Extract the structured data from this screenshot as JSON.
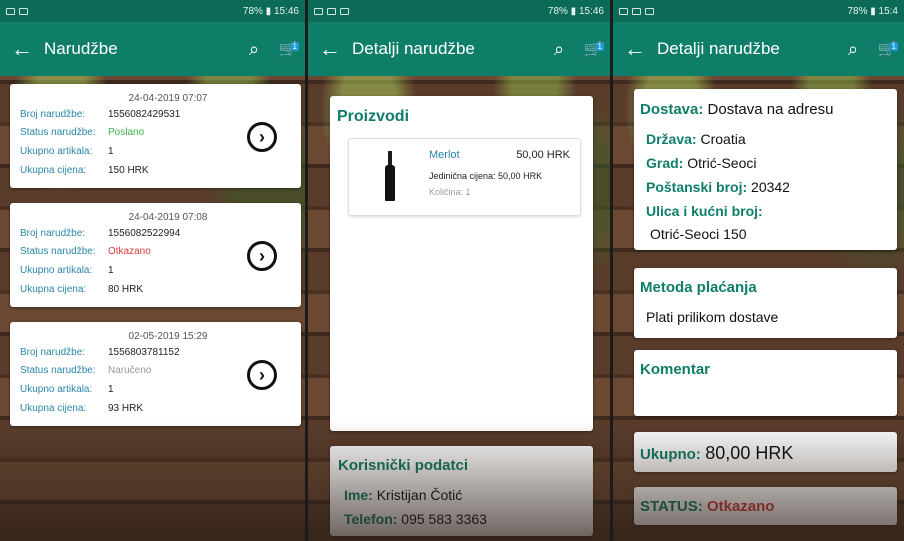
{
  "status_bar": {
    "p1": {
      "signal": "78%",
      "time": "15:46"
    },
    "p2": {
      "signal": "78%",
      "time": "15:46"
    },
    "p3": {
      "signal": "78%",
      "time": "15:4"
    }
  },
  "screen1": {
    "title": "Narudžbe",
    "cart_badge": "1",
    "orders": [
      {
        "date": "24-04-2019 07:07",
        "k_number": "Broj narudžbe:",
        "number": "1556082429531",
        "k_status": "Status narudžbe:",
        "status": "Poslano",
        "k_items": "Ukupno artikala:",
        "items": "1",
        "k_total": "Ukupna cijena:",
        "total": "150 HRK"
      },
      {
        "date": "24-04-2019 07:08",
        "k_number": "Broj narudžbe:",
        "number": "1556082522994",
        "k_status": "Status narudžbe:",
        "status": "Otkazano",
        "k_items": "Ukupno artikala:",
        "items": "1",
        "k_total": "Ukupna cijena:",
        "total": "80 HRK"
      },
      {
        "date": "02-05-2019 15:29",
        "k_number": "Broj narudžbe:",
        "number": "1556803781152",
        "k_status": "Status narudžbe:",
        "status": "Naručeno",
        "k_items": "Ukupno artikala:",
        "items": "1",
        "k_total": "Ukupna cijena:",
        "total": "93 HRK"
      }
    ]
  },
  "screen2": {
    "title": "Detalji narudžbe",
    "cart_badge": "1",
    "products_title": "Proizvodi",
    "product": {
      "name": "Merlot",
      "price": "50,00 HRK",
      "unit_price": "Jedinična cijena:  50,00 HRK",
      "quantity": "Količina:  1"
    },
    "user_title": "Korisnički podatci",
    "name_label": "Ime:",
    "name": "Kristijan Čotić",
    "phone_label": "Telefon:",
    "phone": "095 583 3363"
  },
  "screen3": {
    "title": "Detalji narudžbe",
    "cart_badge": "1",
    "delivery_label": "Dostava:",
    "delivery": "Dostava na adresu",
    "country_label": "Država:",
    "country": "Croatia",
    "city_label": "Grad:",
    "city": "Otrić-Seoci",
    "zip_label": "Poštanski broj:",
    "zip": "20342",
    "street_label": "Ulica i kućni broj:",
    "street": "Otrić-Seoci 150",
    "payment_title": "Metoda plaćanja",
    "payment": "Plati prilikom dostave",
    "comment_title": "Komentar",
    "total_label": "Ukupno:",
    "total": "80,00 HRK",
    "status_label": "STATUS:",
    "status": "Otkazano"
  }
}
